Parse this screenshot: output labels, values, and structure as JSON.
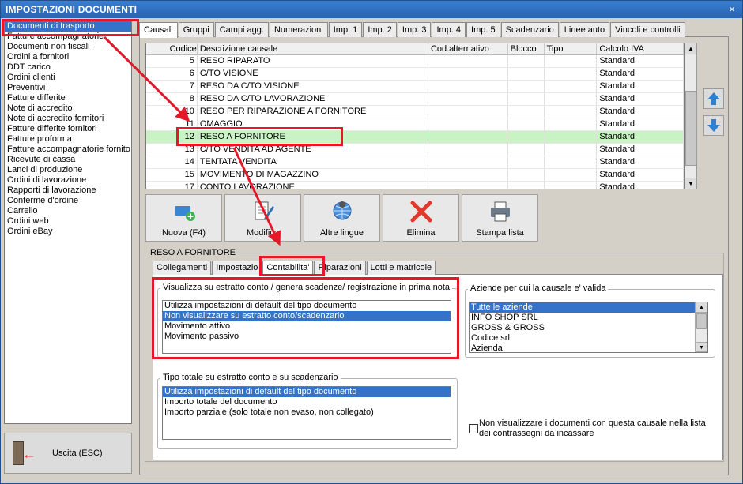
{
  "window": {
    "title": "IMPOSTAZIONI DOCUMENTI",
    "close_glyph": "×"
  },
  "left_list": [
    "Documenti di trasporto",
    "Fatture accompagnatorie",
    "Documenti non fiscali",
    "Ordini a fornitori",
    "DDT carico",
    "Ordini clienti",
    "Preventivi",
    "Fatture differite",
    "Note di accredito",
    "Note di accredito fornitori",
    "Fatture differite fornitori",
    "Fatture proforma",
    "Fatture accompagnatorie fornito",
    "Ricevute di cassa",
    "Lanci di produzione",
    "Ordini di lavorazione",
    "Rapporti di lavorazione",
    "Conferme d'ordine",
    "Carrello",
    "Ordini web",
    "Ordini eBay"
  ],
  "left_list_selected": "Documenti di trasporto",
  "exit_button": {
    "label": "Uscita (ESC)",
    "icon": "exit-door-icon"
  },
  "tabs": [
    "Causali",
    "Gruppi",
    "Campi agg.",
    "Numerazioni",
    "Imp. 1",
    "Imp. 2",
    "Imp. 3",
    "Imp. 4",
    "Imp. 5",
    "Scadenzario",
    "Linee auto",
    "Vincoli e controlli"
  ],
  "active_tab": "Causali",
  "grid": {
    "columns": [
      "Codice",
      "Descrizione causale",
      "Cod.alternativo",
      "Blocco",
      "Tipo",
      "Calcolo IVA"
    ],
    "rows": [
      [
        "5",
        "RESO RIPARATO",
        "",
        "",
        "",
        "Standard"
      ],
      [
        "6",
        "C/TO VISIONE",
        "",
        "",
        "",
        "Standard"
      ],
      [
        "7",
        "RESO DA C/TO VISIONE",
        "",
        "",
        "",
        "Standard"
      ],
      [
        "8",
        "RESO DA C/TO LAVORAZIONE",
        "",
        "",
        "",
        "Standard"
      ],
      [
        "10",
        "RESO PER RIPARAZIONE A FORNITORE",
        "",
        "",
        "",
        "Standard"
      ],
      [
        "11",
        "OMAGGIO",
        "",
        "",
        "",
        "Standard"
      ],
      [
        "12",
        "RESO A FORNITORE",
        "",
        "",
        "",
        "Standard"
      ],
      [
        "13",
        "C/TO VENDITA AD AGENTE",
        "",
        "",
        "",
        "Standard"
      ],
      [
        "14",
        "TENTATA VENDITA",
        "",
        "",
        "",
        "Standard"
      ],
      [
        "15",
        "MOVIMENTO DI MAGAZZINO",
        "",
        "",
        "",
        "Standard"
      ],
      [
        "17",
        "CONTO LAVORAZIONE",
        "",
        "",
        "",
        "Standard"
      ]
    ],
    "selected_code": "12"
  },
  "toolbar": [
    {
      "label": "Nuova (F4)",
      "icon": "new-card-icon"
    },
    {
      "label": "Modifica",
      "icon": "edit-document-icon"
    },
    {
      "label": "Altre lingue",
      "icon": "globe-pin-icon"
    },
    {
      "label": "Elimina",
      "icon": "red-x-icon"
    },
    {
      "label": "Stampa lista",
      "icon": "printer-icon"
    }
  ],
  "detail": {
    "group_title": "RESO A FORNITORE",
    "subtabs": [
      "Collegamenti",
      "Impostazio",
      "Contabilita'",
      "Riparazioni",
      "Lotti e matricole"
    ],
    "active_subtab": "Contabilita'",
    "estratto": {
      "legend": "Visualizza su estratto conto / genera scadenze/ registrazione  in prima nota",
      "options": [
        "Utilizza impostazioni di default del tipo documento",
        "Non visualizzare su estratto conto/scadenzario",
        "Movimento attivo",
        "Movimento passivo"
      ],
      "selected": "Non visualizzare su estratto conto/scadenzario"
    },
    "aziende": {
      "legend": "Aziende per cui la causale e' valida",
      "options": [
        "Tutte le aziende",
        "INFO SHOP SRL",
        "GROSS & GROSS",
        "Codice srl",
        "Azienda"
      ],
      "selected": "Tutte le aziende"
    },
    "tipo_totale": {
      "legend": "Tipo totale su estratto conto e su scadenzario",
      "options": [
        "Utilizza impostazioni di default del tipo documento",
        "Importo totale del documento",
        "Importo parziale (solo totale non evaso, non collegato)"
      ],
      "selected": "Utilizza impostazioni di default del tipo documento"
    },
    "checkbox": {
      "label": "Non visualizzare i documenti con questa causale nella lista dei contrassegni da incassare",
      "checked": false
    }
  },
  "colors": {
    "selection_blue": "#3572c9",
    "selected_row_green": "#c9f3c4",
    "annotation_red": "#e5182a",
    "titlebar_blue": "#2f6fb5"
  }
}
